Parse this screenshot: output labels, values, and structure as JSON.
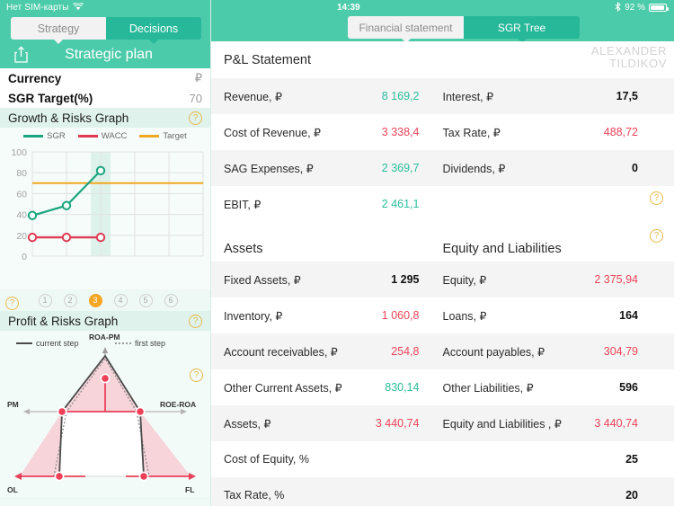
{
  "left": {
    "status": {
      "carrier": "Нет SIM-карты",
      "wifi_icon": "wifi-icon"
    },
    "tabs": [
      {
        "label": "Strategy",
        "active": false
      },
      {
        "label": "Decisions",
        "active": true
      }
    ],
    "share_icon": "share-upload-icon",
    "title": "Strategic plan",
    "params": [
      {
        "key": "Currency",
        "value": "₽"
      },
      {
        "key": "SGR Target(%)",
        "value": "70"
      }
    ],
    "growth_section": {
      "title": "Growth & Risks Graph",
      "help_icon": "help-question-icon"
    },
    "steps": {
      "items": [
        "1",
        "2",
        "3",
        "4",
        "5",
        "6"
      ],
      "current": "3",
      "help_icon": "help-question-icon"
    },
    "profit_section": {
      "title": "Profit & Risks Graph",
      "help_icon": "help-question-icon"
    }
  },
  "right": {
    "status": {
      "time": "14:39",
      "bluetooth_icon": "bluetooth-icon",
      "battery": "92 %",
      "battery_icon": "battery-icon"
    },
    "tabs": [
      {
        "label": "Financial statement",
        "active": false
      },
      {
        "label": "SGR Tree",
        "active": true
      }
    ],
    "pl_title": "P&L Statement",
    "watermark_line1": "ALEXANDER",
    "watermark_line2": "TILDIKOV",
    "pl_rows": [
      {
        "l_label": "Revenue, ₽",
        "l_value": "8 169,2",
        "l_color": "green",
        "r_label": "Interest, ₽",
        "r_value": "17,5",
        "r_color": "dark"
      },
      {
        "l_label": "Cost of Revenue, ₽",
        "l_value": "3 338,4",
        "l_color": "red",
        "r_label": "Tax Rate, ₽",
        "r_value": "488,72",
        "r_color": "red"
      },
      {
        "l_label": "SAG Expenses, ₽",
        "l_value": "2 369,7",
        "l_color": "green",
        "r_label": "Dividends, ₽",
        "r_value": "0",
        "r_color": "dark"
      },
      {
        "l_label": "EBIT, ₽",
        "l_value": "2 461,1",
        "l_color": "green",
        "r_label": "",
        "r_value": "",
        "r_color": "dark"
      }
    ],
    "bs_head_left": "Assets",
    "bs_head_right": "Equity and Liabilities",
    "bs_rows": [
      {
        "l_label": "Fixed Assets, ₽",
        "l_value": "1 295",
        "l_color": "dark",
        "r_label": "Equity, ₽",
        "r_value": "2 375,94",
        "r_color": "red"
      },
      {
        "l_label": "Inventory, ₽",
        "l_value": "1 060,8",
        "l_color": "red",
        "r_label": "Loans, ₽",
        "r_value": "164",
        "r_color": "dark"
      },
      {
        "l_label": "Account receivables, ₽",
        "l_value": "254,8",
        "l_color": "red",
        "r_label": "Account payables, ₽",
        "r_value": "304,79",
        "r_color": "red"
      },
      {
        "l_label": "Other Current Assets, ₽",
        "l_value": "830,14",
        "l_color": "green",
        "r_label": "Other Liabilities, ₽",
        "r_value": "596",
        "r_color": "dark"
      },
      {
        "l_label": "Assets, ₽",
        "l_value": "3 440,74",
        "l_color": "red",
        "r_label": "Equity and Liabilities , ₽",
        "r_value": "3 440,74",
        "r_color": "red"
      },
      {
        "l_label": "Cost of Equity, %",
        "l_value": "",
        "l_color": "dark",
        "r_label": "",
        "r_value": "25",
        "r_color": "dark"
      },
      {
        "l_label": "Tax Rate, %",
        "l_value": "",
        "l_color": "dark",
        "r_label": "",
        "r_value": "20",
        "r_color": "dark"
      }
    ]
  },
  "colors": {
    "brand_teal": "#4ccbaa",
    "tab_active": "#27b89a",
    "sgr_green": "#1aa57f",
    "wacc_red": "#e03a52",
    "target_orange": "#f0a81e",
    "step_current": "#f5a623",
    "help_gold": "#eab84a",
    "value_green": "#2bbd9b",
    "value_red": "#ef4459",
    "profit_pink": "#f7d4da",
    "profit_line": "#4a4a4a"
  },
  "chart_data": [
    {
      "type": "line",
      "title": "Growth & Risks Graph",
      "x": [
        1,
        2,
        3,
        4,
        5,
        6
      ],
      "xlabel": "",
      "ylabel": "",
      "ylim": [
        0,
        100
      ],
      "yticks": [
        0,
        20,
        40,
        60,
        80,
        100
      ],
      "grid": true,
      "legend_position": "top",
      "highlighted_x": 3,
      "series": [
        {
          "name": "SGR",
          "color": "#1aa57f",
          "values": [
            39,
            48.5,
            82,
            null,
            null,
            null
          ]
        },
        {
          "name": "WACC",
          "color": "#e03a52",
          "values": [
            18,
            18,
            18,
            null,
            null,
            null
          ]
        },
        {
          "name": "Target",
          "color": "#f0a81e",
          "values": [
            70,
            70,
            70,
            70,
            70,
            70
          ]
        }
      ]
    },
    {
      "type": "scatter",
      "title": "Profit & Risks Graph",
      "axis_labels": {
        "top": "ROA-PM",
        "left": "PM",
        "right": "ROE-ROA",
        "bottom_left": "OL",
        "bottom_right": "FL"
      },
      "legend_position": "top",
      "series": [
        {
          "name": "current step",
          "style": "solid",
          "color": "#4a4a4a"
        },
        {
          "name": "first step",
          "style": "dotted",
          "color": "#8c8c8c"
        }
      ]
    }
  ]
}
